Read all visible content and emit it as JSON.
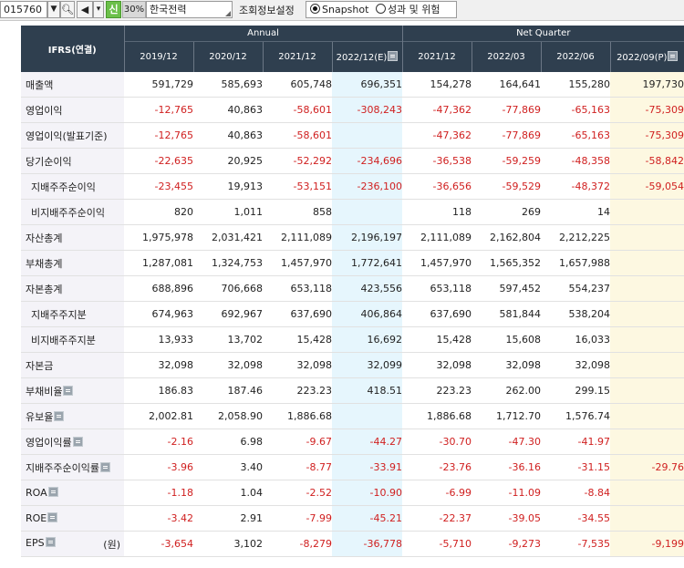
{
  "toolbar": {
    "code": "015760",
    "pct": "30%",
    "sin_label": "신",
    "company": "한국전력",
    "menu_label": "조회정보설정",
    "radio_snapshot": "Snapshot",
    "radio_performance": "성과 및 위험",
    "icons": [
      "chevron-down-icon",
      "search-icon",
      "speaker-icon",
      "chevron-down-icon"
    ]
  },
  "table": {
    "corner_label": "IFRS(연결)",
    "group_annual": "Annual",
    "group_quarter": "Net Quarter",
    "periods": [
      "2019/12",
      "2020/12",
      "2021/12",
      "2022/12(E)",
      "2021/12",
      "2022/03",
      "2022/06",
      "2022/09(P)"
    ],
    "rows": [
      {
        "label": "매출액",
        "values": [
          "591,729",
          "585,693",
          "605,748",
          "696,351",
          "154,278",
          "164,641",
          "155,280",
          "197,730"
        ]
      },
      {
        "label": "영업이익",
        "values": [
          "-12,765",
          "40,863",
          "-58,601",
          "-308,243",
          "-47,362",
          "-77,869",
          "-65,163",
          "-75,309"
        ]
      },
      {
        "label": "영업이익(발표기준)",
        "values": [
          "-12,765",
          "40,863",
          "-58,601",
          "",
          "-47,362",
          "-77,869",
          "-65,163",
          "-75,309"
        ]
      },
      {
        "label": "당기순이익",
        "values": [
          "-22,635",
          "20,925",
          "-52,292",
          "-234,696",
          "-36,538",
          "-59,259",
          "-48,358",
          "-58,842"
        ]
      },
      {
        "label": "지배주주순이익",
        "sub": true,
        "values": [
          "-23,455",
          "19,913",
          "-53,151",
          "-236,100",
          "-36,656",
          "-59,529",
          "-48,372",
          "-59,054"
        ]
      },
      {
        "label": "비지배주주순이익",
        "sub": true,
        "values": [
          "820",
          "1,011",
          "858",
          "",
          "118",
          "269",
          "14",
          ""
        ]
      },
      {
        "label": "자산총계",
        "values": [
          "1,975,978",
          "2,031,421",
          "2,111,089",
          "2,196,197",
          "2,111,089",
          "2,162,804",
          "2,212,225",
          ""
        ]
      },
      {
        "label": "부채총계",
        "values": [
          "1,287,081",
          "1,324,753",
          "1,457,970",
          "1,772,641",
          "1,457,970",
          "1,565,352",
          "1,657,988",
          ""
        ]
      },
      {
        "label": "자본총계",
        "values": [
          "688,896",
          "706,668",
          "653,118",
          "423,556",
          "653,118",
          "597,452",
          "554,237",
          ""
        ]
      },
      {
        "label": "지배주주지분",
        "sub": true,
        "values": [
          "674,963",
          "692,967",
          "637,690",
          "406,864",
          "637,690",
          "581,844",
          "538,204",
          ""
        ]
      },
      {
        "label": "비지배주주지분",
        "sub": true,
        "values": [
          "13,933",
          "13,702",
          "15,428",
          "16,692",
          "15,428",
          "15,608",
          "16,033",
          ""
        ]
      },
      {
        "label": "자본금",
        "values": [
          "32,098",
          "32,098",
          "32,098",
          "32,099",
          "32,098",
          "32,098",
          "32,098",
          ""
        ]
      },
      {
        "label": "부채비율",
        "info": true,
        "values": [
          "186.83",
          "187.46",
          "223.23",
          "418.51",
          "223.23",
          "262.00",
          "299.15",
          ""
        ]
      },
      {
        "label": "유보율",
        "info": true,
        "values": [
          "2,002.81",
          "2,058.90",
          "1,886.68",
          "",
          "1,886.68",
          "1,712.70",
          "1,576.74",
          ""
        ]
      },
      {
        "label": "영업이익률",
        "info": true,
        "values": [
          "-2.16",
          "6.98",
          "-9.67",
          "-44.27",
          "-30.70",
          "-47.30",
          "-41.97",
          ""
        ]
      },
      {
        "label": "지배주주순이익률",
        "info": true,
        "values": [
          "-3.96",
          "3.40",
          "-8.77",
          "-33.91",
          "-23.76",
          "-36.16",
          "-31.15",
          "-29.76"
        ]
      },
      {
        "label": "ROA",
        "info": true,
        "values": [
          "-1.18",
          "1.04",
          "-2.52",
          "-10.90",
          "-6.99",
          "-11.09",
          "-8.84",
          ""
        ]
      },
      {
        "label": "ROE",
        "info": true,
        "values": [
          "-3.42",
          "2.91",
          "-7.99",
          "-45.21",
          "-22.37",
          "-39.05",
          "-34.55",
          ""
        ]
      },
      {
        "label": "EPS",
        "info": true,
        "unit": "(원)",
        "values": [
          "-3,654",
          "3,102",
          "-8,279",
          "-36,778",
          "-5,710",
          "-9,273",
          "-7,535",
          "-9,199"
        ]
      }
    ]
  },
  "colors": {
    "header_bg": "#2f3f4f",
    "negative": "#d02020",
    "estimate_bg": "#e6f6fd",
    "preliminary_bg": "#fdf8e1",
    "label_bg": "#f4f3f8"
  }
}
